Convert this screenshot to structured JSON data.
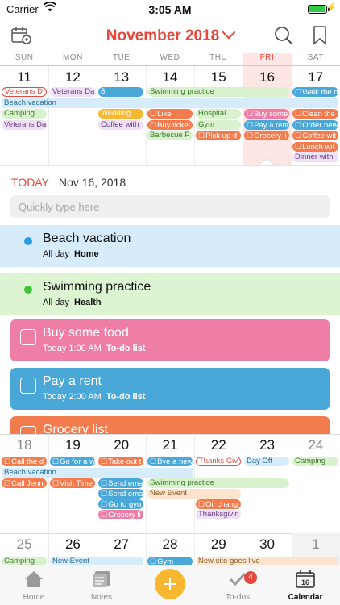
{
  "status_bar": {
    "carrier": "Carrier",
    "time": "3:05 AM",
    "battery_level": 0.95
  },
  "nav": {
    "title": "November 2018"
  },
  "weekdays": [
    "SUN",
    "MON",
    "TUE",
    "WED",
    "THU",
    "FRI",
    "SAT"
  ],
  "week1": {
    "days": [
      "11",
      "12",
      "13",
      "14",
      "15",
      "16",
      "17"
    ],
    "events": {
      "veterans_sun": "Veterans D",
      "veterans_mon": "Veterans Da",
      "tue_icon": "8",
      "swimming": "Swimming practice",
      "walk": "Walk the d",
      "beach": "Beach vacation",
      "camping": "Camping",
      "wedding": "Wedding",
      "like": "Like",
      "hospital": "Hospital",
      "buy_some": "Buy some",
      "clean": "Clean the",
      "veterans_sun2": "Veterans Da",
      "coffee_with": "Coffee with",
      "buy_ticket": "Buy ticket",
      "gym": "Gym",
      "pay_rent": "Pay a rent",
      "order_new": "Order new",
      "barbecue": "Barbecue P",
      "pick_up": "Pick up d",
      "grocery": "Grocery li",
      "coffee_wit": "Coffee wit",
      "lunch": "Lunch wit",
      "dinner": "Dinner with"
    }
  },
  "detail": {
    "today_label": "TODAY",
    "date": "Nov 16, 2018",
    "quick_placeholder": "Quickly type here",
    "cards": [
      {
        "title": "Beach vacation",
        "when": "All day",
        "where": "Home"
      },
      {
        "title": "Swimming practice",
        "when": "All day",
        "where": "Health"
      },
      {
        "title": "Buy some food",
        "when": "Today 1:00 AM",
        "where": "To-do list"
      },
      {
        "title": "Pay a rent",
        "when": "Today 2:00 AM",
        "where": "To-do list"
      },
      {
        "title": "Grocery list",
        "when": "",
        "where": ""
      }
    ]
  },
  "week2": {
    "days": [
      "18",
      "19",
      "20",
      "21",
      "22",
      "23",
      "24"
    ],
    "events": {
      "call_the": "Call the d",
      "go_for": "Go for a w",
      "take_out": "Take out t",
      "bye": "Bye a new",
      "thanksgiv": "Thanks Giv",
      "day_off": "Day Off",
      "camping": "Camping",
      "beach": "Beach vacation",
      "call_jenni": "Call Jenni",
      "visit_time": "Visit Time",
      "send_em1": "Send ema",
      "swimming": "Swimming practice",
      "send_em2": "Send ema",
      "new_event": "New Event",
      "go_to_gym": "Go to gyn",
      "oil_change": "Oil chang",
      "grocery": "Grocery li",
      "thanksgivin": "Thanksgivin"
    }
  },
  "week3": {
    "days": [
      "25",
      "26",
      "27",
      "28",
      "29",
      "30",
      "1"
    ],
    "events": {
      "camping": "Camping",
      "new_event": "New Event",
      "gym": "Gym",
      "new_site": "New site goes live"
    }
  },
  "tabs": {
    "home": "Home",
    "notes": "Notes",
    "todos": "To-dos",
    "calendar": "Calendar",
    "todos_badge": "4",
    "calendar_day": "16"
  },
  "colors": {
    "accent": "#e8473c",
    "add_button": "#f7b731"
  }
}
